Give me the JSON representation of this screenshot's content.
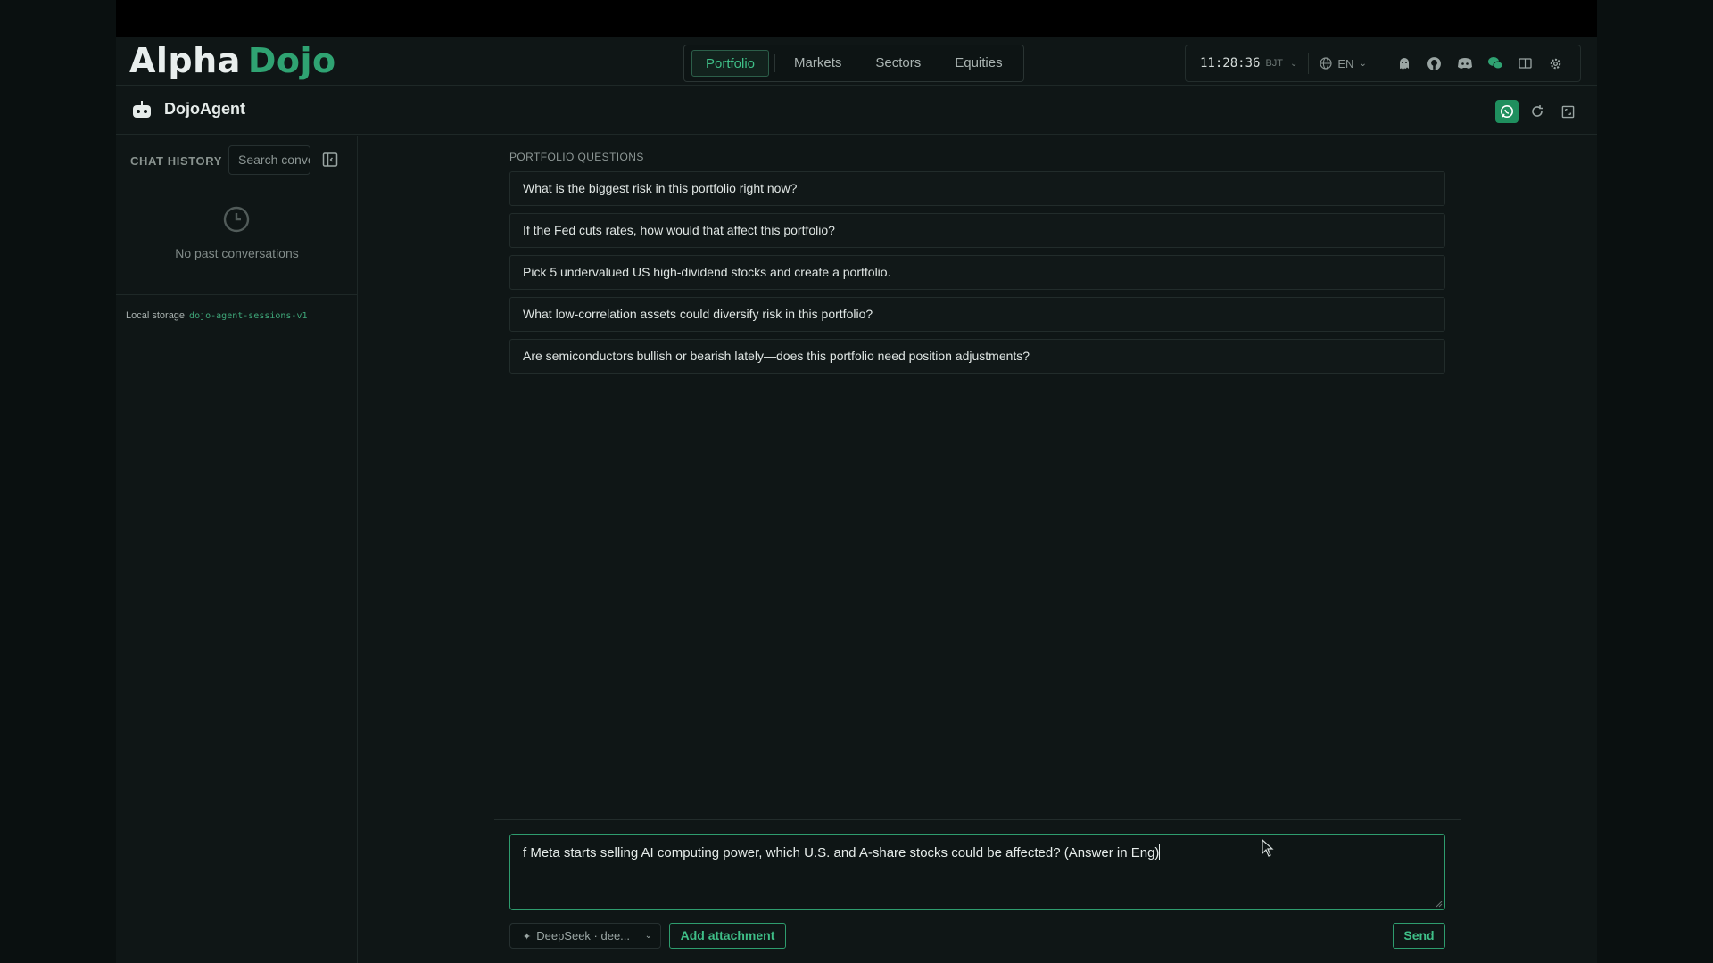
{
  "brand": {
    "part1": "Alpha",
    "part2": "Dojo",
    "accent": "#2fa372"
  },
  "nav": {
    "tabs": [
      {
        "label": "Portfolio",
        "active": true
      },
      {
        "label": "Markets",
        "active": false
      },
      {
        "label": "Sectors",
        "active": false
      },
      {
        "label": "Equities",
        "active": false
      }
    ]
  },
  "status": {
    "time": "11:28:36",
    "timezone": "BJT",
    "language": "EN"
  },
  "agent": {
    "title": "DojoAgent"
  },
  "sidebar": {
    "history_label": "CHAT HISTORY",
    "search_placeholder": "Search conversations",
    "empty_text": "No past conversations",
    "storage_label": "Local storage",
    "storage_key": "dojo-agent-sessions-v1"
  },
  "questions": {
    "title": "PORTFOLIO QUESTIONS",
    "items": [
      "What is the biggest risk in this portfolio right now?",
      "If the Fed cuts rates, how would that affect this portfolio?",
      "Pick 5 undervalued US high-dividend stocks and create a portfolio.",
      "What low-correlation assets could diversify risk in this portfolio?",
      "Are semiconductors bullish or bearish lately—does this portfolio need position adjustments?"
    ]
  },
  "composer": {
    "value": "f Meta starts selling AI computing power, which U.S. and A-share stocks could be affected?  (Answer in Eng)",
    "model": "DeepSeek · dee...",
    "attach_label": "Add attachment",
    "send_label": "Send"
  }
}
